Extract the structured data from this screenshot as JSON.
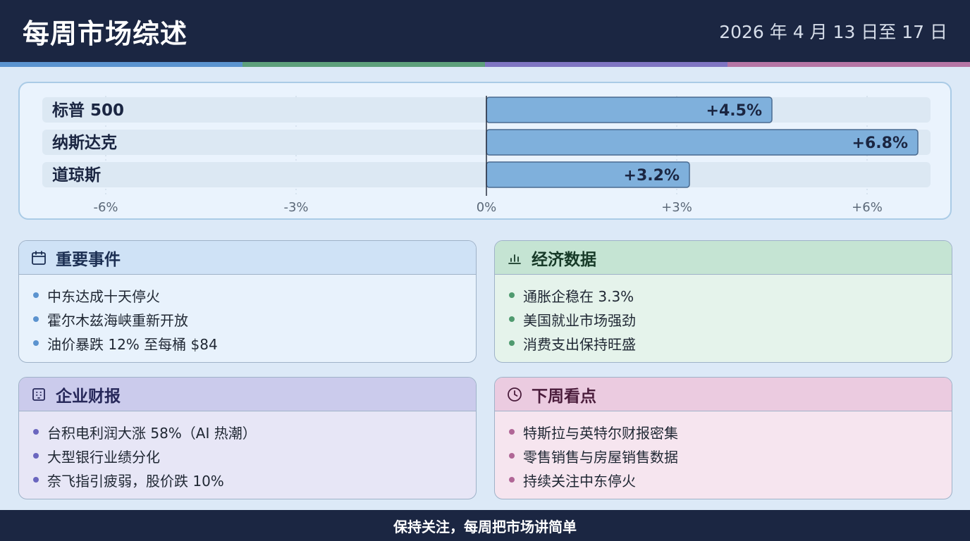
{
  "header": {
    "title": "每周市场综述",
    "date_range": "2026 年 4 月 13 日至 17 日"
  },
  "accent_colors": [
    "#5b93cf",
    "#5ea07c",
    "#7f75c2",
    "#b676a5"
  ],
  "chart_data": {
    "type": "bar",
    "orientation": "horizontal",
    "categories": [
      "标普 500",
      "纳斯达克",
      "道琼斯"
    ],
    "values": [
      4.5,
      6.8,
      3.2
    ],
    "value_labels": [
      "+4.5%",
      "+6.8%",
      "+3.2%"
    ],
    "xlim": [
      -6,
      6
    ],
    "ticks": [
      -6,
      -3,
      0,
      3,
      6
    ],
    "tick_labels": [
      "-6%",
      "-3%",
      "0%",
      "+3%",
      "+6%"
    ],
    "grid": true,
    "bar_color": "#7fb0dc"
  },
  "cards": {
    "events": {
      "title": "重要事件",
      "icon": "calendar-icon",
      "items": [
        "中东达成十天停火",
        "霍尔木兹海峡重新开放",
        "油价暴跌 12% 至每桶 $84"
      ],
      "head_color": "#cfe2f6",
      "body_color": "#e8f2fc",
      "dot_color": "#5b93cf",
      "title_color": "#1b2e52"
    },
    "economy": {
      "title": "经济数据",
      "icon": "bar-chart-icon",
      "items": [
        "通胀企稳在 3.3%",
        "美国就业市场强劲",
        "消费支出保持旺盛"
      ],
      "head_color": "#c5e4d3",
      "body_color": "#e5f3eb",
      "dot_color": "#4f9a6f",
      "title_color": "#173a28"
    },
    "earnings": {
      "title": "企业财报",
      "icon": "building-icon",
      "items": [
        "台积电利润大涨 58%（AI 热潮）",
        "大型银行业绩分化",
        "奈飞指引疲弱，股价跌 10%"
      ],
      "head_color": "#cbcbec",
      "body_color": "#e7e6f6",
      "dot_color": "#6a66bf",
      "title_color": "#27285a"
    },
    "next_week": {
      "title": "下周看点",
      "icon": "clock-icon",
      "items": [
        "特斯拉与英特尔财报密集",
        "零售销售与房屋销售数据",
        "持续关注中东停火"
      ],
      "head_color": "#ebcbe0",
      "body_color": "#f6e5ef",
      "dot_color": "#b06696",
      "title_color": "#4a1c3b"
    }
  },
  "footer": {
    "text": "保持关注，每周把市场讲简单"
  }
}
